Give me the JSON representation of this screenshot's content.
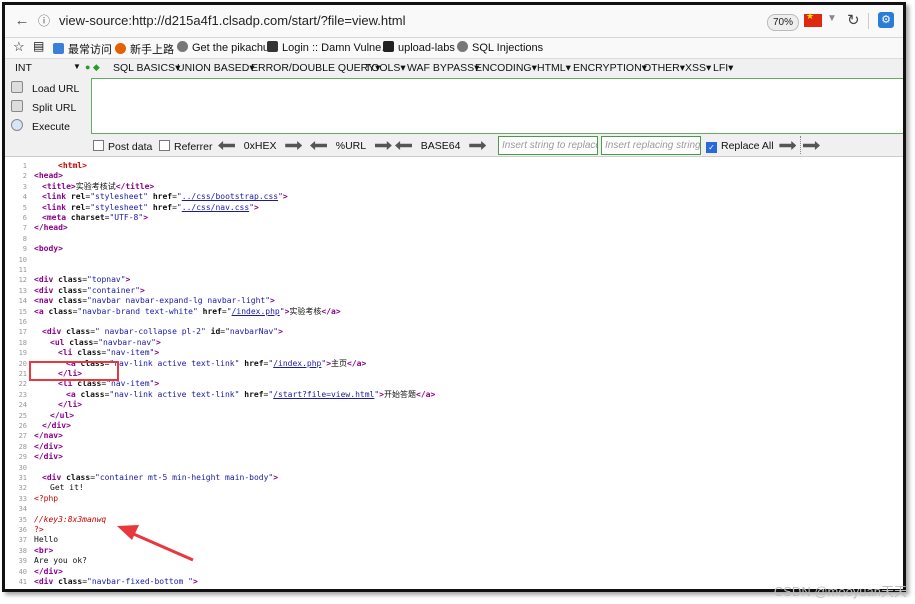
{
  "urlbar": {
    "url": "view-source:http://d215a4f1.clsadp.com/start/?file=view.html",
    "zoom": "70%"
  },
  "bookmarks": [
    {
      "label": "最常访问",
      "icon": "globe-icon",
      "color": "#3c7fd8"
    },
    {
      "label": "新手上路",
      "icon": "firefox-icon",
      "color": "#e66000"
    },
    {
      "label": "Get the pikachu",
      "icon": "globe-icon",
      "color": "#777777"
    },
    {
      "label": "Login :: Damn Vulne…",
      "icon": "dvwa-icon",
      "color": "#333333"
    },
    {
      "label": "upload-labs",
      "icon": "camera-icon",
      "color": "#222222"
    },
    {
      "label": "SQL Injections",
      "icon": "globe-icon",
      "color": "#777777"
    }
  ],
  "hackbar": {
    "selector": "INT",
    "menu": [
      "SQL BASICS",
      "UNION BASED",
      "ERROR/DOUBLE QUERY",
      "TOOLS",
      "WAF BYPASS",
      "ENCODING",
      "HTML",
      "ENCRYPTION",
      "OTHER",
      "XSS",
      "LFI"
    ],
    "actions": {
      "load": "Load URL",
      "split": "Split URL",
      "execute": "Execute"
    },
    "post_data": "Post data",
    "referrer": "Referrer",
    "hex": "0xHEX",
    "url_enc": "%URL",
    "base64": "BASE64",
    "find_placeholder": "Insert string to replace",
    "replace_placeholder": "Insert replacing string",
    "replace_all": "Replace All"
  },
  "source_lines": [
    {
      "n": "1",
      "html": "<span class='tagred'>&lt;html&gt;</span>",
      "indent": 3
    },
    {
      "n": "2",
      "html": "<span class='tag'>&lt;head&gt;</span>",
      "indent": 0
    },
    {
      "n": "3",
      "html": "<span class='tag'>&lt;title&gt;</span>实验考核试<span class='tag'>&lt;/title&gt;</span>",
      "indent": 1
    },
    {
      "n": "4",
      "html": "<span class='tag'>&lt;link</span> <span class='attr'>rel</span>=<span class='val'>\"stylesheet\"</span> <span class='attr'>href</span>=<span class='val'>\"</span><span class='lnk'>../css/bootstrap.css</span><span class='val'>\"</span><span class='tag'>&gt;</span>",
      "indent": 1
    },
    {
      "n": "5",
      "html": "<span class='tag'>&lt;link</span> <span class='attr'>rel</span>=<span class='val'>\"stylesheet\"</span> <span class='attr'>href</span>=<span class='val'>\"</span><span class='lnk'>../css/nav.css</span><span class='val'>\"</span><span class='tag'>&gt;</span>",
      "indent": 1
    },
    {
      "n": "6",
      "html": "<span class='tag'>&lt;meta</span> <span class='attr'>charset</span>=<span class='val'>\"UTF-8\"</span><span class='tag'>&gt;</span>",
      "indent": 1
    },
    {
      "n": "7",
      "html": "<span class='tag'>&lt;/head&gt;</span>",
      "indent": 0
    },
    {
      "n": "8",
      "html": "",
      "indent": 0
    },
    {
      "n": "9",
      "html": "<span class='tag'>&lt;body&gt;</span>",
      "indent": 0
    },
    {
      "n": "10",
      "html": "",
      "indent": 0
    },
    {
      "n": "11",
      "html": "",
      "indent": 0
    },
    {
      "n": "12",
      "html": "<span class='tag'>&lt;div</span> <span class='attr'>class</span>=<span class='val'>\"topnav\"</span><span class='tag'>&gt;</span>",
      "indent": 0
    },
    {
      "n": "13",
      "html": "<span class='tag'>&lt;div</span> <span class='attr'>class</span>=<span class='val'>\"container\"</span><span class='tag'>&gt;</span>",
      "indent": 0
    },
    {
      "n": "14",
      "html": "<span class='tag'>&lt;nav</span> <span class='attr'>class</span>=<span class='val'>\"navbar navbar-expand-lg navbar-light\"</span><span class='tag'>&gt;</span>",
      "indent": 0
    },
    {
      "n": "15",
      "html": "<span class='tag'>&lt;a</span> <span class='attr'>class</span>=<span class='val'>\"navbar-brand text-white\"</span> <span class='attr'>href</span>=<span class='val'>\"</span><span class='lnk'>/index.php</span><span class='val'>\"</span><span class='tag'>&gt;</span>实验考核<span class='tag'>&lt;/a&gt;</span>",
      "indent": 0
    },
    {
      "n": "16",
      "html": "",
      "indent": 0
    },
    {
      "n": "17",
      "html": "<span class='tag'>&lt;div</span> <span class='attr'>class</span>=<span class='val'>\" navbar-collapse pl-2\"</span> <span class='attr'>id</span>=<span class='val'>\"navbarNav\"</span><span class='tag'>&gt;</span>",
      "indent": 1
    },
    {
      "n": "18",
      "html": "<span class='tag'>&lt;ul</span> <span class='attr'>class</span>=<span class='val'>\"navbar-nav\"</span><span class='tag'>&gt;</span>",
      "indent": 2
    },
    {
      "n": "19",
      "html": "<span class='tag'>&lt;li</span> <span class='attr'>class</span>=<span class='val'>\"nav-item\"</span><span class='tag'>&gt;</span>",
      "indent": 3
    },
    {
      "n": "20",
      "html": "<span class='tag'>&lt;a</span> <span class='attr'>class</span>=<span class='val'>\"nav-link active text-link\"</span> <span class='attr'>href</span>=<span class='val'>\"</span><span class='lnk'>/index.php</span><span class='val'>\"</span><span class='tag'>&gt;</span>主页<span class='tag'>&lt;/a&gt;</span>",
      "indent": 4
    },
    {
      "n": "21",
      "html": "<span class='tag'>&lt;/li&gt;</span>",
      "indent": 3
    },
    {
      "n": "22",
      "html": "<span class='tag'>&lt;li</span> <span class='attr'>class</span>=<span class='val'>\"nav-item\"</span><span class='tag'>&gt;</span>",
      "indent": 3
    },
    {
      "n": "23",
      "html": "<span class='tag'>&lt;a</span> <span class='attr'>class</span>=<span class='val'>\"nav-link active text-link\"</span> <span class='attr'>href</span>=<span class='val'>\"</span><span class='lnk'>/start?file=view.html</span><span class='val'>\"</span><span class='tag'>&gt;</span>开始答题<span class='tag'>&lt;/a&gt;</span>",
      "indent": 4
    },
    {
      "n": "24",
      "html": "<span class='tag'>&lt;/li&gt;</span>",
      "indent": 3
    },
    {
      "n": "25",
      "html": "<span class='tag'>&lt;/ul&gt;</span>",
      "indent": 2
    },
    {
      "n": "26",
      "html": "<span class='tag'>&lt;/div&gt;</span>",
      "indent": 1
    },
    {
      "n": "27",
      "html": "<span class='tag'>&lt;/nav&gt;</span>",
      "indent": 0
    },
    {
      "n": "28",
      "html": "<span class='tag'>&lt;/div&gt;</span>",
      "indent": 0
    },
    {
      "n": "29",
      "html": "<span class='tag'>&lt;/div&gt;</span>",
      "indent": 0
    },
    {
      "n": "30",
      "html": "",
      "indent": 0
    },
    {
      "n": "31",
      "html": "<span class='tag'>&lt;div</span> <span class='attr'>class</span>=<span class='val'>\"container mt-5 min-height main-body\"</span><span class='tag'>&gt;</span>",
      "indent": 1
    },
    {
      "n": "32",
      "html": "Get it!",
      "indent": 2
    },
    {
      "n": "33",
      "html": "<span class='php'>&lt;?php</span>",
      "indent": 0
    },
    {
      "n": "34",
      "html": "",
      "indent": 0
    },
    {
      "n": "35",
      "html": "<span class='cm'>//key3:8x3manwq</span>",
      "indent": 0
    },
    {
      "n": "36",
      "html": "<span class='php'>?&gt;</span>",
      "indent": 0
    },
    {
      "n": "37",
      "html": "Hello",
      "indent": 0
    },
    {
      "n": "38",
      "html": "<span class='tag'>&lt;br&gt;</span>",
      "indent": 0
    },
    {
      "n": "39",
      "html": "Are you ok?",
      "indent": 0
    },
    {
      "n": "40",
      "html": "<span class='tag'>&lt;/div&gt;</span>",
      "indent": 0
    },
    {
      "n": "41",
      "html": "<span class='tag'>&lt;div</span> <span class='attr'>class</span>=<span class='val'>\"navbar-fixed-bottom \"</span><span class='tag'>&gt;</span>",
      "indent": 0
    }
  ],
  "watermark": "CSDN @mooyuan天天",
  "colors": {
    "highlight": "#e8383d",
    "hackbar_border": "#4a9a4a"
  }
}
